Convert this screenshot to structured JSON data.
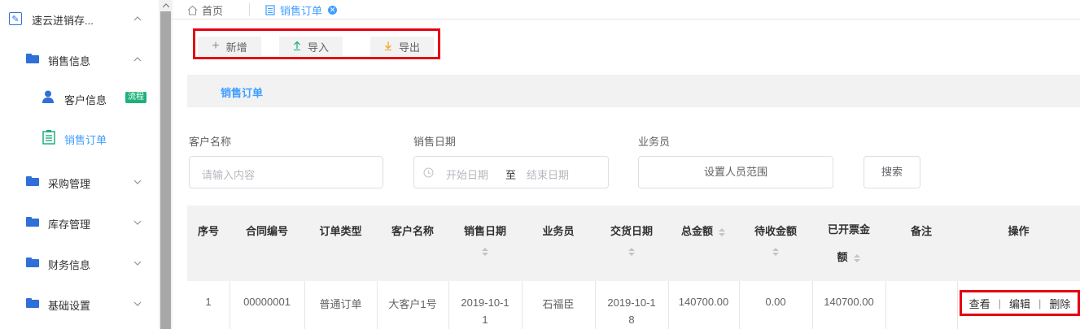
{
  "sidebar": {
    "app_name": "速云进销存...",
    "items": [
      {
        "label": "销售信息"
      },
      {
        "label": "客户信息",
        "badge": "流程"
      },
      {
        "label": "销售订单"
      },
      {
        "label": "采购管理"
      },
      {
        "label": "库存管理"
      },
      {
        "label": "财务信息"
      },
      {
        "label": "基础设置"
      }
    ]
  },
  "tabs": {
    "home": "首页",
    "active": "销售订单",
    "close": "✕"
  },
  "toolbar": {
    "add": "新增",
    "import": "导入",
    "export": "导出"
  },
  "section": {
    "title": "销售订单"
  },
  "filters": {
    "customer_label": "客户名称",
    "customer_placeholder": "请输入内容",
    "date_label": "销售日期",
    "start_placeholder": "开始日期",
    "range_sep": "至",
    "end_placeholder": "结束日期",
    "salesman_label": "业务员",
    "salesman_button": "设置人员范围",
    "search_button": "搜索"
  },
  "table": {
    "headers": [
      "序号",
      "合同编号",
      "订单类型",
      "客户名称",
      "销售日期",
      "业务员",
      "交货日期",
      "总金额",
      "待收金额",
      "已开票金",
      "额",
      "备注",
      "操作"
    ],
    "row": {
      "index": "1",
      "contract_no": "00000001",
      "order_type": "普通订单",
      "customer": "大客户1号",
      "sale_date_1": "2019-10-1",
      "sale_date_2": "1",
      "salesman": "石福臣",
      "delivery_date_1": "2019-10-1",
      "delivery_date_2": "8",
      "total": "140700.00",
      "receivable": "0.00",
      "invoiced": "140700.00",
      "note": ""
    },
    "ops": {
      "view": "查看",
      "edit": "编辑",
      "delete": "删除",
      "sep": "|"
    }
  },
  "colors": {
    "accent": "#409eff",
    "highlight_border": "#e60012",
    "badge": "#1fb17a",
    "import_icon": "#1fb17a",
    "export_icon": "#f5a623"
  }
}
